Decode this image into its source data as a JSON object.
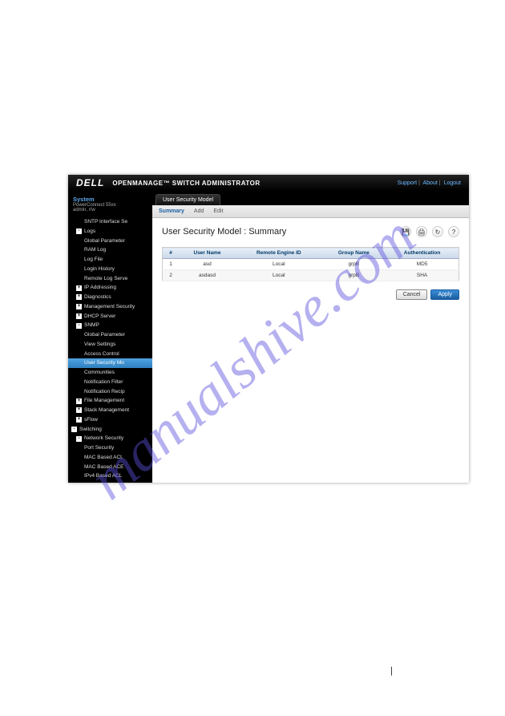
{
  "watermark": "manualshive.com",
  "header": {
    "brand": "DELL",
    "product": "OPENMANAGE™ SWITCH ADMINISTRATOR",
    "links": {
      "support": "Support",
      "about": "About",
      "logout": "Logout"
    }
  },
  "sidebar": {
    "system_label": "System",
    "device": "PowerConnect 55xx",
    "user": "admin, r/w",
    "items": [
      {
        "label": "SNTP Interface Se",
        "lvl": 2
      },
      {
        "label": "Logs",
        "lvl": 1,
        "exp": "-"
      },
      {
        "label": "Global Parameter",
        "lvl": 2
      },
      {
        "label": "RAM Log",
        "lvl": 2
      },
      {
        "label": "Log File",
        "lvl": 2
      },
      {
        "label": "Login History",
        "lvl": 2
      },
      {
        "label": "Remote Log Serve",
        "lvl": 2
      },
      {
        "label": "IP Addressing",
        "lvl": 1,
        "exp": "+"
      },
      {
        "label": "Diagnostics",
        "lvl": 1,
        "exp": "+"
      },
      {
        "label": "Management Security",
        "lvl": 1,
        "exp": "+"
      },
      {
        "label": "DHCP Server",
        "lvl": 1,
        "exp": "+"
      },
      {
        "label": "SNMP",
        "lvl": 1,
        "exp": "-"
      },
      {
        "label": "Global Parameter",
        "lvl": 2
      },
      {
        "label": "View Settings",
        "lvl": 2
      },
      {
        "label": "Access Control",
        "lvl": 2
      },
      {
        "label": "User Security Mo",
        "lvl": 2,
        "active": true
      },
      {
        "label": "Communities",
        "lvl": 2
      },
      {
        "label": "Notification Filter",
        "lvl": 2
      },
      {
        "label": "Notification Recip",
        "lvl": 2
      },
      {
        "label": "File Management",
        "lvl": 1,
        "exp": "+"
      },
      {
        "label": "Stack Management",
        "lvl": 1,
        "exp": "+"
      },
      {
        "label": "sFlow",
        "lvl": 1,
        "exp": "+"
      },
      {
        "label": "Switching",
        "lvl": 0,
        "exp": "-"
      },
      {
        "label": "Network Security",
        "lvl": 1,
        "exp": "-"
      },
      {
        "label": "Port Security",
        "lvl": 2
      },
      {
        "label": "MAC Based ACL",
        "lvl": 2
      },
      {
        "label": "MAC Based ACE",
        "lvl": 2
      },
      {
        "label": "IPv4 Based ACL",
        "lvl": 2
      }
    ]
  },
  "tabs": {
    "main": "User Security Model"
  },
  "subtabs": {
    "summary": "Summary",
    "add": "Add",
    "edit": "Edit"
  },
  "page": {
    "title": "User Security Model : Summary",
    "toolbar": {
      "save": "H",
      "print": "print",
      "refresh": "C",
      "help": "?"
    },
    "columns": {
      "idx": "#",
      "user": "User Name",
      "engine": "Remote Engine ID",
      "group": "Group Name",
      "auth": "Authentication"
    },
    "rows": [
      {
        "idx": "1",
        "user": "asd",
        "engine": "Local",
        "group": "grpB",
        "auth": "MD5"
      },
      {
        "idx": "2",
        "user": "asdasd",
        "engine": "Local",
        "group": "grpB",
        "auth": "SHA"
      }
    ],
    "buttons": {
      "cancel": "Cancel",
      "apply": "Apply"
    }
  },
  "footer_sep": "|"
}
